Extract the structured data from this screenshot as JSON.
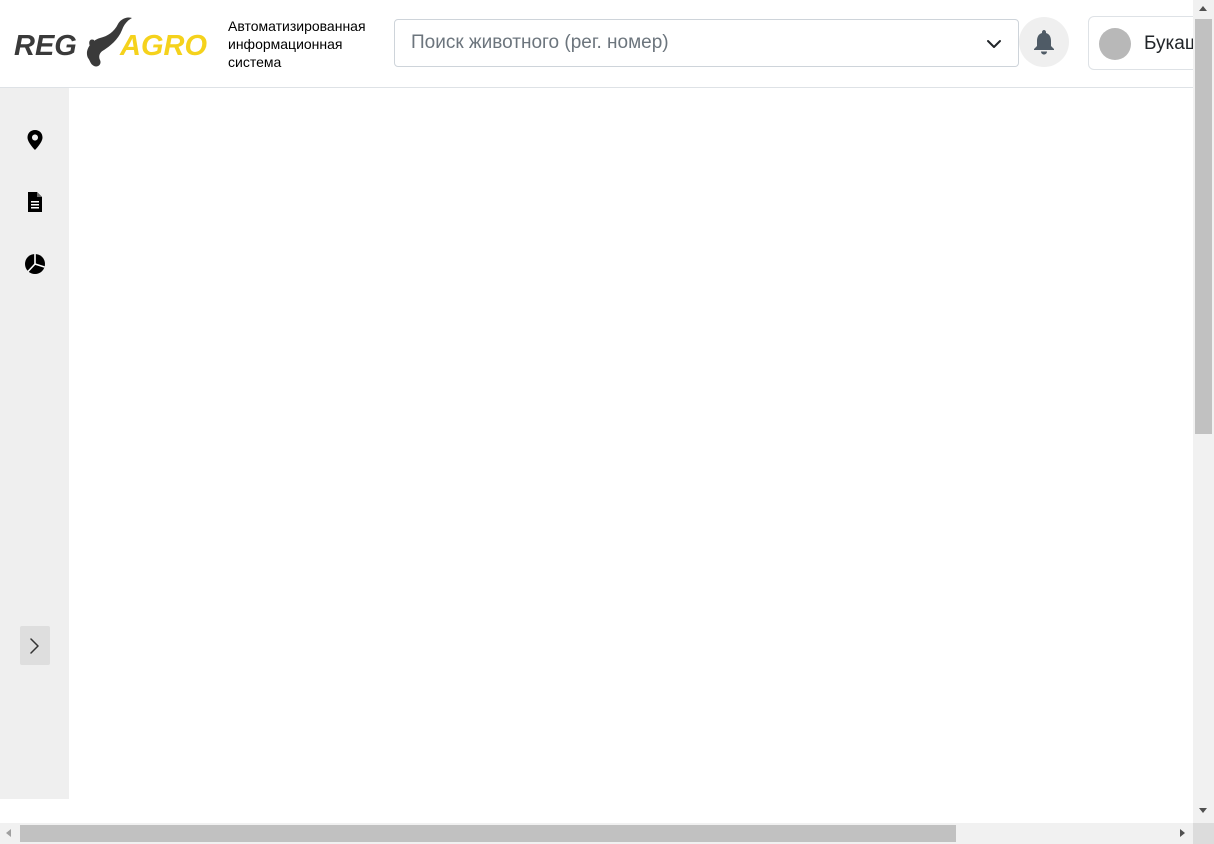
{
  "header": {
    "logo_text_left": "REG",
    "logo_text_right": "AGRO",
    "subtitle_lines": [
      "Автоматизированная",
      "информационная",
      "система"
    ],
    "search": {
      "placeholder": "Поиск животного (рег. номер)",
      "value": ""
    },
    "notifications_icon": "bell-icon",
    "user": {
      "name": "Букаш"
    }
  },
  "sidebar": {
    "items": [
      {
        "icon": "map-marker-icon"
      },
      {
        "icon": "document-icon"
      },
      {
        "icon": "pie-chart-icon"
      }
    ],
    "expand_icon": "chevron-right-icon"
  },
  "colors": {
    "logo_dark": "#3a3a3a",
    "logo_accent": "#f5d21c",
    "sidebar_bg": "#efefef",
    "avatar": "#b8b8b8"
  }
}
